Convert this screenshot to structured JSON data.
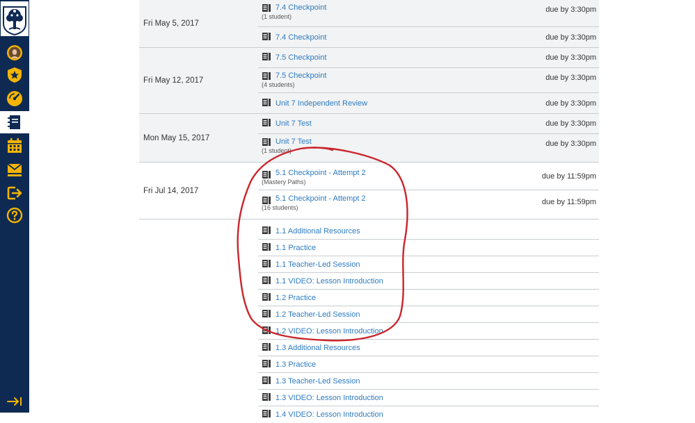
{
  "nav": {
    "items": [
      {
        "icon": "profile-avatar-icon",
        "active": false
      },
      {
        "icon": "badge-star-icon",
        "active": false
      },
      {
        "icon": "dashboard-gauge-icon",
        "active": false
      },
      {
        "icon": "courses-notebook-icon",
        "active": true
      },
      {
        "icon": "calendar-icon",
        "active": false
      },
      {
        "icon": "inbox-icon",
        "active": false
      },
      {
        "icon": "logout-arrow-icon",
        "active": false
      },
      {
        "icon": "help-icon",
        "active": false
      }
    ],
    "collapse_icon": "collapse-arrow-icon"
  },
  "groups": [
    {
      "date": "Fri May 5, 2017",
      "items": [
        {
          "title": "7.4 Checkpoint",
          "sub": "(1 student)",
          "due": "due by 3:30pm"
        },
        {
          "title": "7.4 Checkpoint",
          "sub": "",
          "due": "due by 3:30pm"
        }
      ]
    },
    {
      "date": "Fri May 12, 2017",
      "items": [
        {
          "title": "7.5 Checkpoint",
          "sub": "",
          "due": "due by 3:30pm"
        },
        {
          "title": "7.5 Checkpoint",
          "sub": "(4 students)",
          "due": "due by 3:30pm"
        },
        {
          "title": "Unit 7 Independent Review",
          "sub": "",
          "due": "due by 3:30pm"
        }
      ]
    },
    {
      "date": "Mon May 15, 2017",
      "items": [
        {
          "title": "Unit 7 Test",
          "sub": "",
          "due": "due by 3:30pm"
        },
        {
          "title": "Unit 7 Test",
          "sub": "(1 student)",
          "due": "due by 3:30pm"
        }
      ]
    },
    {
      "date": "Fri Jul 14, 2017",
      "items": [
        {
          "title": "5.1 Checkpoint - Attempt 2",
          "sub": "(Mastery Paths)",
          "due": "due by 11:59pm"
        },
        {
          "title": "5.1 Checkpoint - Attempt 2",
          "sub": "(16 students)",
          "due": "due by 11:59pm"
        }
      ]
    }
  ],
  "undated_items": [
    "1.1 Additional Resources",
    "1.1 Practice",
    "1.1 Teacher-Led Session",
    "1.1 VIDEO: Lesson Introduction",
    "1.2 Practice",
    "1.2 Teacher-Led Session",
    "1.2 VIDEO: Lesson Introduction",
    "1.3 Additional Resources",
    "1.3 Practice",
    "1.3 Teacher-Led Session",
    "1.3 VIDEO: Lesson Introduction",
    "1.4 VIDEO: Lesson Introduction"
  ],
  "colors": {
    "nav_bg": "#0e2a52",
    "nav_icon": "#f4b400",
    "link": "#2d7bbf",
    "annotation": "#c9252c"
  }
}
